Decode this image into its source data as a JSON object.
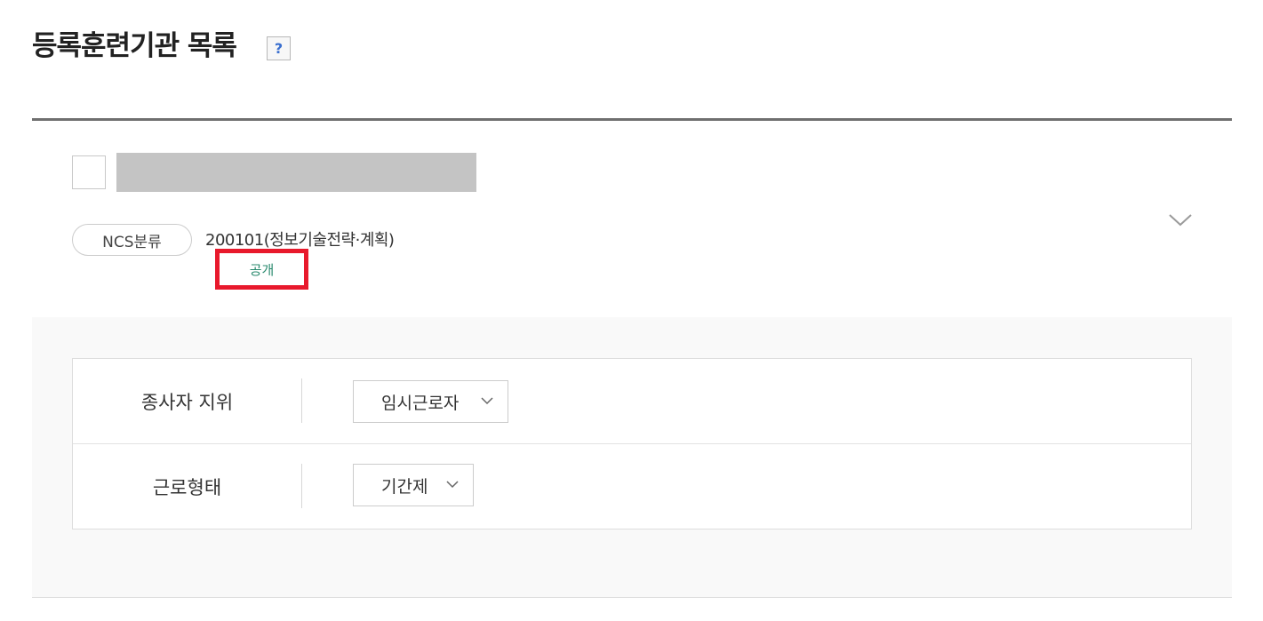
{
  "page": {
    "title": "등록훈련기관 목록",
    "help_label": "?"
  },
  "item": {
    "ncs_label": "NCS분류",
    "ncs_value": "200101(정보기술전략·계획)",
    "public_label": "공개"
  },
  "details": {
    "rows": [
      {
        "label": "종사자 지위",
        "value": "임시근로자"
      },
      {
        "label": "근로형태",
        "value": "기간제"
      }
    ]
  },
  "colors": {
    "highlight_border": "#e8192c",
    "public_text": "#2a8a6e",
    "help_icon": "#3a6fcf"
  },
  "icons": {
    "help": "question-icon",
    "expand": "chevron-down-icon",
    "select": "chevron-down-icon"
  }
}
